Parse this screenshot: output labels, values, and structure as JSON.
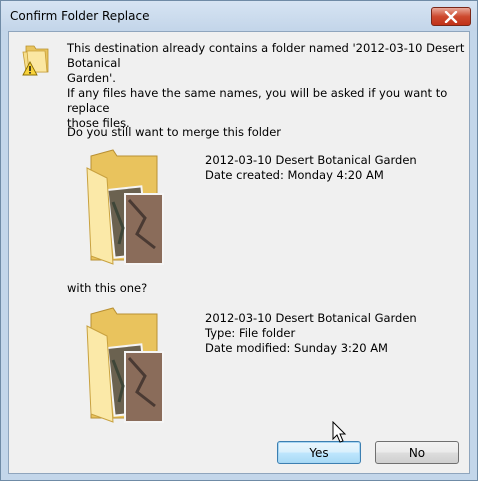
{
  "window": {
    "title": "Confirm Folder Replace"
  },
  "message": {
    "line1": "This destination already contains a folder named '2012-03-10 Desert Botanical",
    "line2": "Garden'.",
    "line3": "If any files have the same names, you will be asked if you want to replace",
    "line4": "those files.",
    "question": "Do you still want to merge this folder"
  },
  "source_folder": {
    "name": "2012-03-10 Desert Botanical Garden",
    "date_created": "Date created: Monday 4:20 AM"
  },
  "with_label": "with this one?",
  "destination_folder": {
    "name": "2012-03-10 Desert Botanical Garden",
    "type": "Type: File folder",
    "date_modified": "Date modified: Sunday 3:20 AM"
  },
  "buttons": {
    "yes": "Yes",
    "no": "No"
  },
  "icons": {
    "warning": "warning-folder-icon",
    "folder": "folder-with-photos-icon",
    "close": "close-icon",
    "cursor": "mouse-pointer-icon"
  }
}
